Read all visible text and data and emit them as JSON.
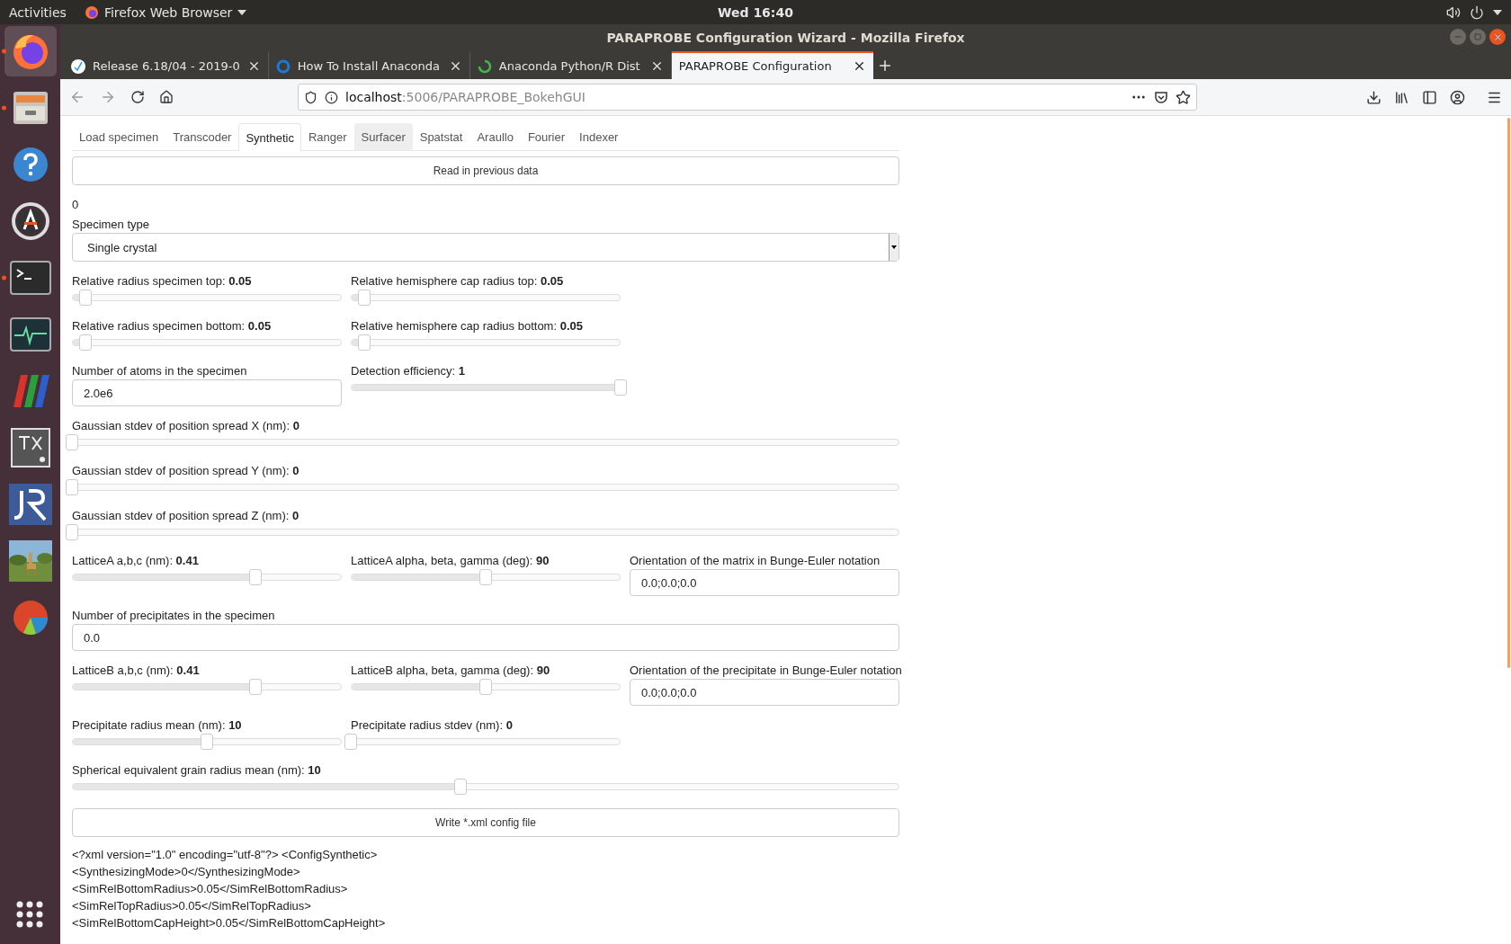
{
  "top_bar": {
    "activities": "Activities",
    "app_menu": "Firefox Web Browser",
    "clock": "Wed 16:40"
  },
  "window": {
    "title": "PARAPROBE Configuration Wizard - Mozilla Firefox"
  },
  "dock": {
    "items": [
      {
        "kind": "firefox",
        "running": true,
        "selected": true
      },
      {
        "kind": "files",
        "running": true,
        "selected": false
      },
      {
        "kind": "help",
        "running": false,
        "selected": false
      },
      {
        "kind": "updater",
        "running": false,
        "selected": false
      },
      {
        "kind": "terminal",
        "running": true,
        "selected": false
      },
      {
        "kind": "monitor",
        "running": false,
        "selected": false
      },
      {
        "kind": "stripes",
        "running": false,
        "selected": false
      },
      {
        "kind": "texmaker",
        "running": false,
        "selected": false
      },
      {
        "kind": "jr",
        "running": false,
        "selected": false
      },
      {
        "kind": "picture",
        "running": false,
        "selected": false
      },
      {
        "kind": "piechart",
        "running": false,
        "selected": false
      }
    ]
  },
  "browser_tabs": [
    {
      "title": "Release 6.18/04 - 2019-0",
      "kind": "check",
      "selected": false
    },
    {
      "title": "How To Install Anaconda",
      "kind": "ring",
      "selected": false
    },
    {
      "title": "Anaconda Python/R Dist",
      "kind": "spinner",
      "selected": false
    },
    {
      "title": "PARAPROBE Configuration",
      "kind": "none",
      "selected": true
    }
  ],
  "address_bar": {
    "host": "localhost",
    "path": ":5006/PARAPROBE_BokehGUI"
  },
  "app_tabs": [
    {
      "label": "Load specimen",
      "selected": false,
      "hovered": false
    },
    {
      "label": "Transcoder",
      "selected": false,
      "hovered": false
    },
    {
      "label": "Synthetic",
      "selected": true,
      "hovered": false
    },
    {
      "label": "Ranger",
      "selected": false,
      "hovered": false
    },
    {
      "label": "Surfacer",
      "selected": false,
      "hovered": true
    },
    {
      "label": "Spatstat",
      "selected": false,
      "hovered": false
    },
    {
      "label": "Araullo",
      "selected": false,
      "hovered": false
    },
    {
      "label": "Fourier",
      "selected": false,
      "hovered": false
    },
    {
      "label": "Indexer",
      "selected": false,
      "hovered": false
    }
  ],
  "read_button": "Read in previous data",
  "counter": "0",
  "specimen_type": {
    "label": "Specimen type",
    "value": "Single crystal"
  },
  "rows": [
    [
      {
        "kind": "slider",
        "label": "Relative radius specimen top: **0.05**",
        "level": 0.05
      },
      {
        "kind": "slider",
        "label": "Relative hemisphere cap radius top: **0.05**",
        "level": 0.05
      }
    ],
    [
      {
        "kind": "slider",
        "label": "Relative radius specimen bottom: **0.05**",
        "level": 0.05
      },
      {
        "kind": "slider",
        "label": "Relative hemisphere cap radius bottom: **0.05**",
        "level": 0.05
      }
    ],
    [
      {
        "kind": "input",
        "label": "Number of atoms in the specimen",
        "value": "2.0e6"
      },
      {
        "kind": "slider",
        "label": "Detection efficiency: **1**",
        "level": 1
      }
    ],
    [
      {
        "kind": "slider",
        "label": "Gaussian stdev of position spread X (nm): **0**",
        "level": 0
      }
    ],
    [
      {
        "kind": "slider",
        "label": "Gaussian stdev of position spread Y (nm): **0**",
        "level": 0
      }
    ],
    [
      {
        "kind": "slider",
        "label": "Gaussian stdev of position spread Z (nm): **0**",
        "level": 0
      }
    ],
    [
      {
        "kind": "slider",
        "label": "LatticeA a,b,c (nm): **0.41**",
        "level": 0.68
      },
      {
        "kind": "slider",
        "label": "LatticeA alpha, beta, gamma (deg): **90**",
        "level": 0.5
      },
      {
        "kind": "input",
        "label": "Orientation of the matrix in Bunge-Euler notation",
        "value": "0.0;0.0;0.0"
      }
    ],
    [
      {
        "kind": "input",
        "label": "Number of precipitates in the specimen",
        "value": "0.0"
      }
    ],
    [
      {
        "kind": "slider",
        "label": "LatticeB a,b,c (nm): **0.41**",
        "level": 0.68
      },
      {
        "kind": "slider",
        "label": "LatticeB alpha, beta, gamma (deg): **90**",
        "level": 0.5
      },
      {
        "kind": "input",
        "label": "Orientation of the precipitate in Bunge-Euler notation",
        "value": "0.0;0.0;0.0"
      }
    ],
    [
      {
        "kind": "slider",
        "label": "Precipitate radius mean (nm): **10**",
        "level": 0.5
      },
      {
        "kind": "slider",
        "label": "Precipitate radius stdev (nm): **0**",
        "level": 0
      }
    ],
    [
      {
        "kind": "slider",
        "label": "Spherical equivalent grain radius mean (nm): **10**",
        "level": 0.47
      }
    ]
  ],
  "write_button": "Write *.xml config file",
  "xml_lines": [
    "<?xml version=\"1.0\" encoding=\"utf-8\"?> <ConfigSynthetic>",
    "<SynthesizingMode>0</SynthesizingMode>",
    "<SimRelBottomRadius>0.05</SimRelBottomRadius>",
    "<SimRelTopRadius>0.05</SimRelTopRadius>",
    "<SimRelBottomCapHeight>0.05</SimRelBottomCapHeight>"
  ]
}
